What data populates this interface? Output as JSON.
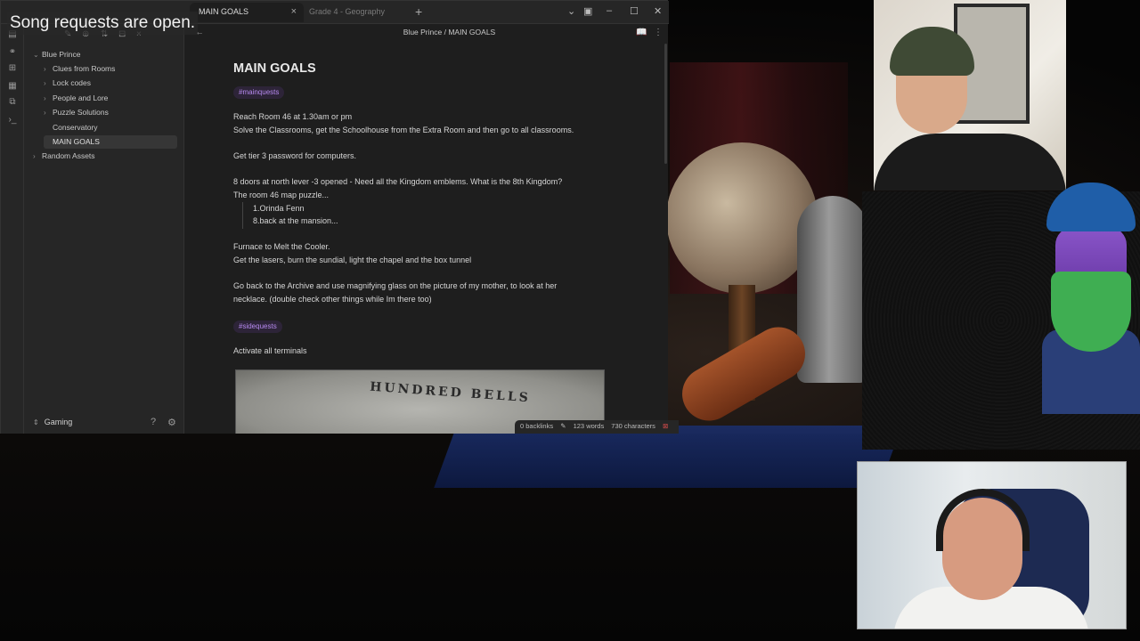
{
  "overlay": {
    "text": "Song requests are open."
  },
  "tabs": [
    {
      "label": "MAIN GOALS",
      "active": true
    },
    {
      "label": "Grade 4 - Geography",
      "active": false
    }
  ],
  "breadcrumb": "Blue Prince / MAIN GOALS",
  "sidebar": {
    "items": [
      {
        "label": "Blue Prince",
        "expanded": true
      },
      {
        "label": "Clues from Rooms"
      },
      {
        "label": "Lock codes"
      },
      {
        "label": "People and Lore"
      },
      {
        "label": "Puzzle Solutions"
      },
      {
        "label": "Conservatory"
      },
      {
        "label": "MAIN GOALS",
        "active": true
      },
      {
        "label": "Random Assets"
      }
    ],
    "vault_name": "Gaming"
  },
  "note": {
    "title": "MAIN GOALS",
    "tag_main": "#mainquests",
    "lines": [
      "Reach Room 46 at 1.30am or pm",
      "Solve the Classrooms, get the Schoolhouse from the Extra Room and then go to all classrooms.",
      "Get tier 3 password for computers.",
      "8 doors at north lever -3 opened - Need all the Kingdom emblems. What is the 8th Kingdom?",
      "The room 46 map puzzle...",
      "1.Orinda Fenn",
      "8.back at the mansion...",
      "Furnace to Melt the Cooler.",
      "Get the lasers, burn the sundial, light the chapel and the box tunnel",
      "Go back to the Archive and use magnifying glass on the picture of my mother, to look at her",
      "necklace. (double check other things while Im there too)"
    ],
    "tag_side": "#sidequests",
    "side_line": "Activate all terminals",
    "image_text": "HUNDRED BELLS"
  },
  "status": {
    "backlinks": "0 backlinks",
    "words": "123 words",
    "characters": "730 characters"
  },
  "colors": {
    "accent": "#b78af0",
    "background": "#1e1e1e",
    "sidebar": "#262626"
  }
}
